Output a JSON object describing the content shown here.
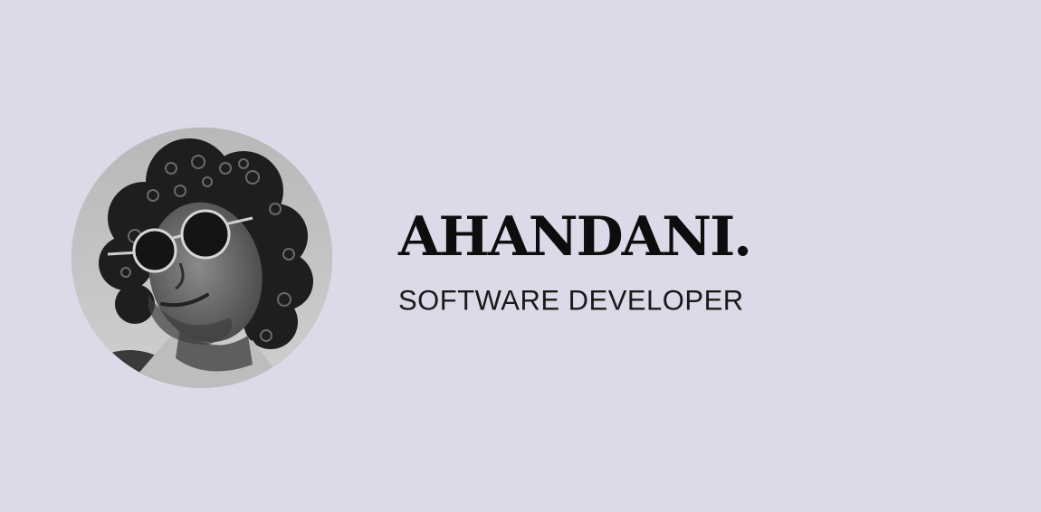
{
  "hero": {
    "name": "AHANDANI.",
    "role": "SOFTWARE DEVELOPER"
  },
  "colors": {
    "background": "#dcd9e8",
    "text": "#0d0d0d"
  }
}
